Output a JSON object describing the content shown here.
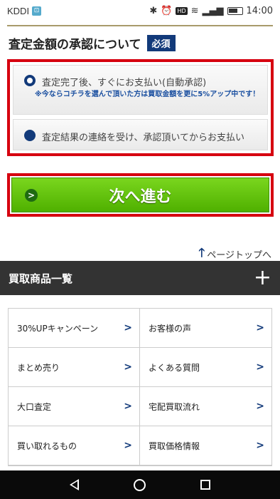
{
  "status_bar": {
    "carrier": "KDDI",
    "hd_label": "HD",
    "time": "14:00"
  },
  "header": {
    "title": "査定金額の承認について",
    "required_badge": "必須"
  },
  "approval_options": [
    {
      "label": "査定完了後、すぐにお支払い(自動承認)",
      "note": "※今ならコチラを選んで頂いた方は買取金額を更に5%アップ中です！",
      "selected": true
    },
    {
      "label": "査定結果の連絡を受け、承認頂いてからお支払い",
      "selected": false
    }
  ],
  "next_button": {
    "label": "次へ進む"
  },
  "page_top": {
    "label": "ページトップへ"
  },
  "category_section": {
    "title": "買取商品一覧",
    "expand_symbol": "+"
  },
  "links": [
    {
      "label": "30%UPキャンペーン"
    },
    {
      "label": "お客様の声"
    },
    {
      "label": "まとめ売り"
    },
    {
      "label": "よくある質問"
    },
    {
      "label": "大口査定"
    },
    {
      "label": "宅配買取流れ"
    },
    {
      "label": "買い取れるもの"
    },
    {
      "label": "買取価格情報"
    }
  ],
  "colors": {
    "navy": "#123a7a",
    "red_highlight": "#d6000f",
    "green_button": "#5dbf00",
    "dark_bar": "#333333"
  }
}
